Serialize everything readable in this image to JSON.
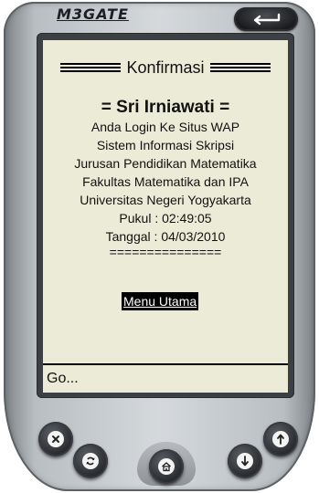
{
  "device": {
    "brand": "M3GATE",
    "icons": {
      "back": "back-arrow-icon",
      "close": "close-icon",
      "refresh": "refresh-icon",
      "home": "home-icon",
      "down": "arrow-down-icon",
      "up": "arrow-up-icon"
    }
  },
  "page": {
    "title": "Konfirmasi",
    "user_name": "= Sri Irniawati =",
    "lines": [
      "Anda Login Ke Situs WAP",
      "Sistem Informasi Skripsi",
      "Jurusan Pendidikan Matematika",
      "Fakultas Matematika dan IPA",
      "Universitas Negeri Yogyakarta",
      "Pukul : 02:49:05",
      "Tanggal : 04/03/2010"
    ],
    "separator": "===============",
    "menu_link": "Menu Utama"
  },
  "go_bar": {
    "text": "Go..."
  }
}
